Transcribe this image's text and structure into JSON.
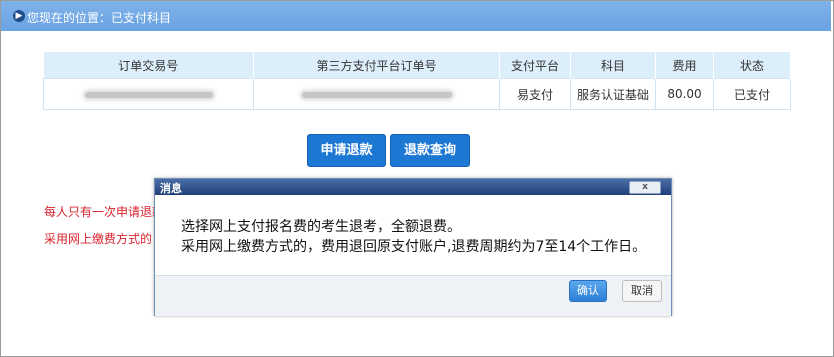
{
  "header": {
    "location": "您现在的位置：已支付科目"
  },
  "table": {
    "columns": [
      "订单交易号",
      "第三方支付平台订单号",
      "支付平台",
      "科目",
      "费用",
      "状态"
    ],
    "rows": [
      {
        "payment_platform": "易支付",
        "subject": "服务认证基础",
        "fee": "80.00",
        "status": "已支付"
      }
    ]
  },
  "actions": {
    "refund_apply": "申请退款",
    "refund_query": "退款查询"
  },
  "notes": {
    "line1": "每人只有一次申请退款",
    "line2": "采用网上缴费方式的，"
  },
  "dialog": {
    "title": "消息",
    "close_label": "x",
    "line1": "选择网上支付报名费的考生退考，全额退费。",
    "line2": "采用网上缴费方式的，费用退回原支付账户,退费周期约为7至14个工作日。",
    "ok": "确认",
    "cancel": "取消"
  }
}
